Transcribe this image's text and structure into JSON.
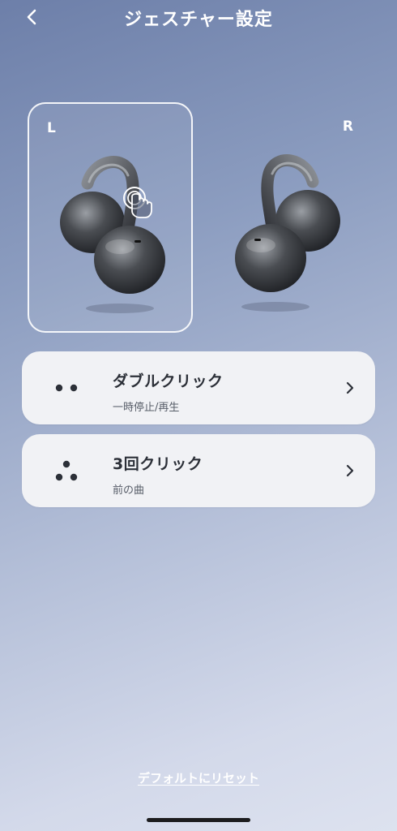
{
  "header": {
    "title": "ジェスチャー設定",
    "back_icon": "chevron-left-icon"
  },
  "earbuds": {
    "left_label": "L",
    "right_label": "R",
    "selected": "L",
    "tap_icon": "hand-tap-icon"
  },
  "gestures": [
    {
      "title": "ダブルクリック",
      "action": "一時停止/再生",
      "icon": "two-dots-icon"
    },
    {
      "title": "3回クリック",
      "action": "前の曲",
      "icon": "three-dots-icon"
    }
  ],
  "footer": {
    "reset_label": "デフォルトにリセット"
  },
  "colors": {
    "card_background": "#f1f2f5",
    "text_dark": "#2c3038",
    "background_top": "#6d7fa9",
    "background_bottom": "#dde2ef"
  }
}
